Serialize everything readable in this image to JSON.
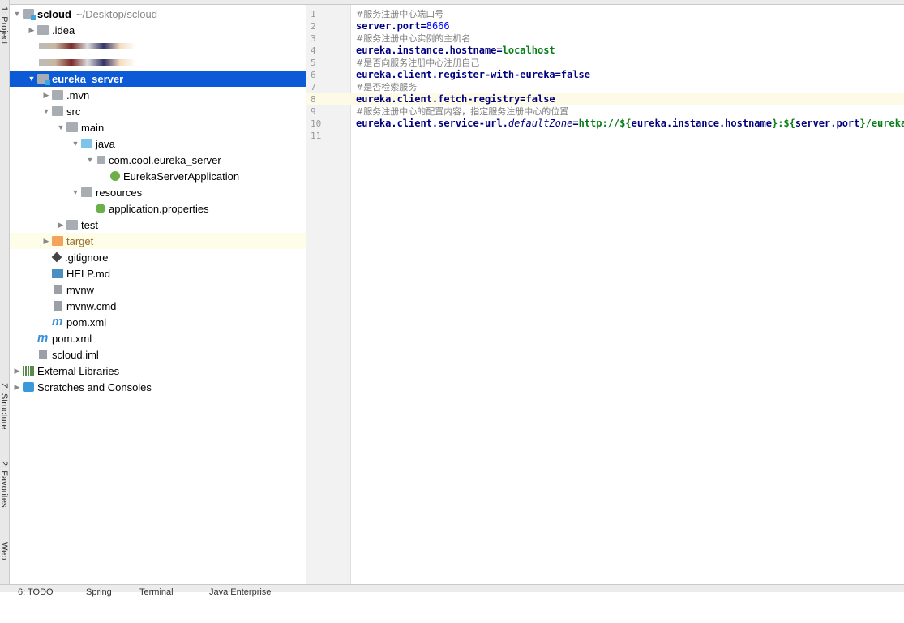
{
  "side_tabs": [
    "1: Project",
    "Z: Structure",
    "2: Favorites",
    "Web"
  ],
  "tree": [
    {
      "label": "scloud",
      "extra": "~/Desktop/scloud",
      "depth": 0,
      "arrow": "down",
      "icon": "module-folder",
      "bold": true
    },
    {
      "label": ".idea",
      "depth": 1,
      "arrow": "right",
      "icon": "folder"
    },
    {
      "label": "",
      "depth": 1,
      "arrow": "none",
      "icon": "blurred"
    },
    {
      "label": "",
      "depth": 1,
      "arrow": "none",
      "icon": "blurred"
    },
    {
      "label": "eureka_server",
      "depth": 1,
      "arrow": "down",
      "icon": "module-folder",
      "selected": true
    },
    {
      "label": ".mvn",
      "depth": 2,
      "arrow": "right",
      "icon": "folder"
    },
    {
      "label": "src",
      "depth": 2,
      "arrow": "down",
      "icon": "folder"
    },
    {
      "label": "main",
      "depth": 3,
      "arrow": "down",
      "icon": "folder"
    },
    {
      "label": "java",
      "depth": 4,
      "arrow": "down",
      "icon": "source-folder"
    },
    {
      "label": "com.cool.eureka_server",
      "depth": 5,
      "arrow": "down",
      "icon": "package"
    },
    {
      "label": "EurekaServerApplication",
      "depth": 6,
      "arrow": "none",
      "icon": "spring-class"
    },
    {
      "label": "resources",
      "depth": 4,
      "arrow": "down",
      "icon": "resources-folder"
    },
    {
      "label": "application.properties",
      "depth": 5,
      "arrow": "none",
      "icon": "spring-properties"
    },
    {
      "label": "test",
      "depth": 3,
      "arrow": "right",
      "icon": "folder"
    },
    {
      "label": "target",
      "depth": 2,
      "arrow": "right",
      "icon": "excluded-folder",
      "ignored": true
    },
    {
      "label": ".gitignore",
      "depth": 2,
      "arrow": "none",
      "icon": "git"
    },
    {
      "label": "HELP.md",
      "depth": 2,
      "arrow": "none",
      "icon": "markdown"
    },
    {
      "label": "mvnw",
      "depth": 2,
      "arrow": "none",
      "icon": "file"
    },
    {
      "label": "mvnw.cmd",
      "depth": 2,
      "arrow": "none",
      "icon": "file"
    },
    {
      "label": "pom.xml",
      "depth": 2,
      "arrow": "none",
      "icon": "maven"
    },
    {
      "label": "pom.xml",
      "depth": 1,
      "arrow": "none",
      "icon": "maven"
    },
    {
      "label": "scloud.iml",
      "depth": 1,
      "arrow": "none",
      "icon": "file"
    },
    {
      "label": "External Libraries",
      "depth": 0,
      "arrow": "right",
      "icon": "libraries"
    },
    {
      "label": "Scratches and Consoles",
      "depth": 0,
      "arrow": "right",
      "icon": "scratches"
    }
  ],
  "editor": {
    "highlighted_line": 8,
    "lines": [
      [
        {
          "t": "#服务注册中心端口号",
          "c": "cm"
        }
      ],
      [
        {
          "t": "server.port",
          "c": "k"
        },
        {
          "t": "=",
          "c": "k"
        },
        {
          "t": "8666",
          "c": "n"
        }
      ],
      [
        {
          "t": "#服务注册中心实例的主机名",
          "c": "cm"
        }
      ],
      [
        {
          "t": "eureka.instance.hostname",
          "c": "k"
        },
        {
          "t": "=",
          "c": "k"
        },
        {
          "t": "localhost",
          "c": "v"
        }
      ],
      [
        {
          "t": "#是否向服务注册中心注册自己",
          "c": "cm"
        }
      ],
      [
        {
          "t": "eureka.client.register-with-eureka",
          "c": "k"
        },
        {
          "t": "=",
          "c": "k"
        },
        {
          "t": "false",
          "c": "k"
        }
      ],
      [
        {
          "t": "#是否检索服务",
          "c": "cm"
        }
      ],
      [
        {
          "t": "eureka.client.fetch-registry",
          "c": "k"
        },
        {
          "t": "=",
          "c": "k"
        },
        {
          "t": "false",
          "c": "k"
        }
      ],
      [
        {
          "t": "#服务注册中心的配置内容，指定服务注册中心的位置",
          "c": "cm"
        }
      ],
      [
        {
          "t": "eureka.client.service-url.",
          "c": "k"
        },
        {
          "t": "defaultZone",
          "c": "it"
        },
        {
          "t": "=",
          "c": "k"
        },
        {
          "t": "http://${",
          "c": "v"
        },
        {
          "t": "eureka.instance.hostname",
          "c": "k"
        },
        {
          "t": "}:${",
          "c": "v"
        },
        {
          "t": "server.port",
          "c": "k"
        },
        {
          "t": "}/eureka/",
          "c": "v"
        }
      ],
      []
    ]
  },
  "bottom_tabs": [
    "6: TODO",
    "Spring",
    "Terminal",
    "Java Enterprise"
  ]
}
